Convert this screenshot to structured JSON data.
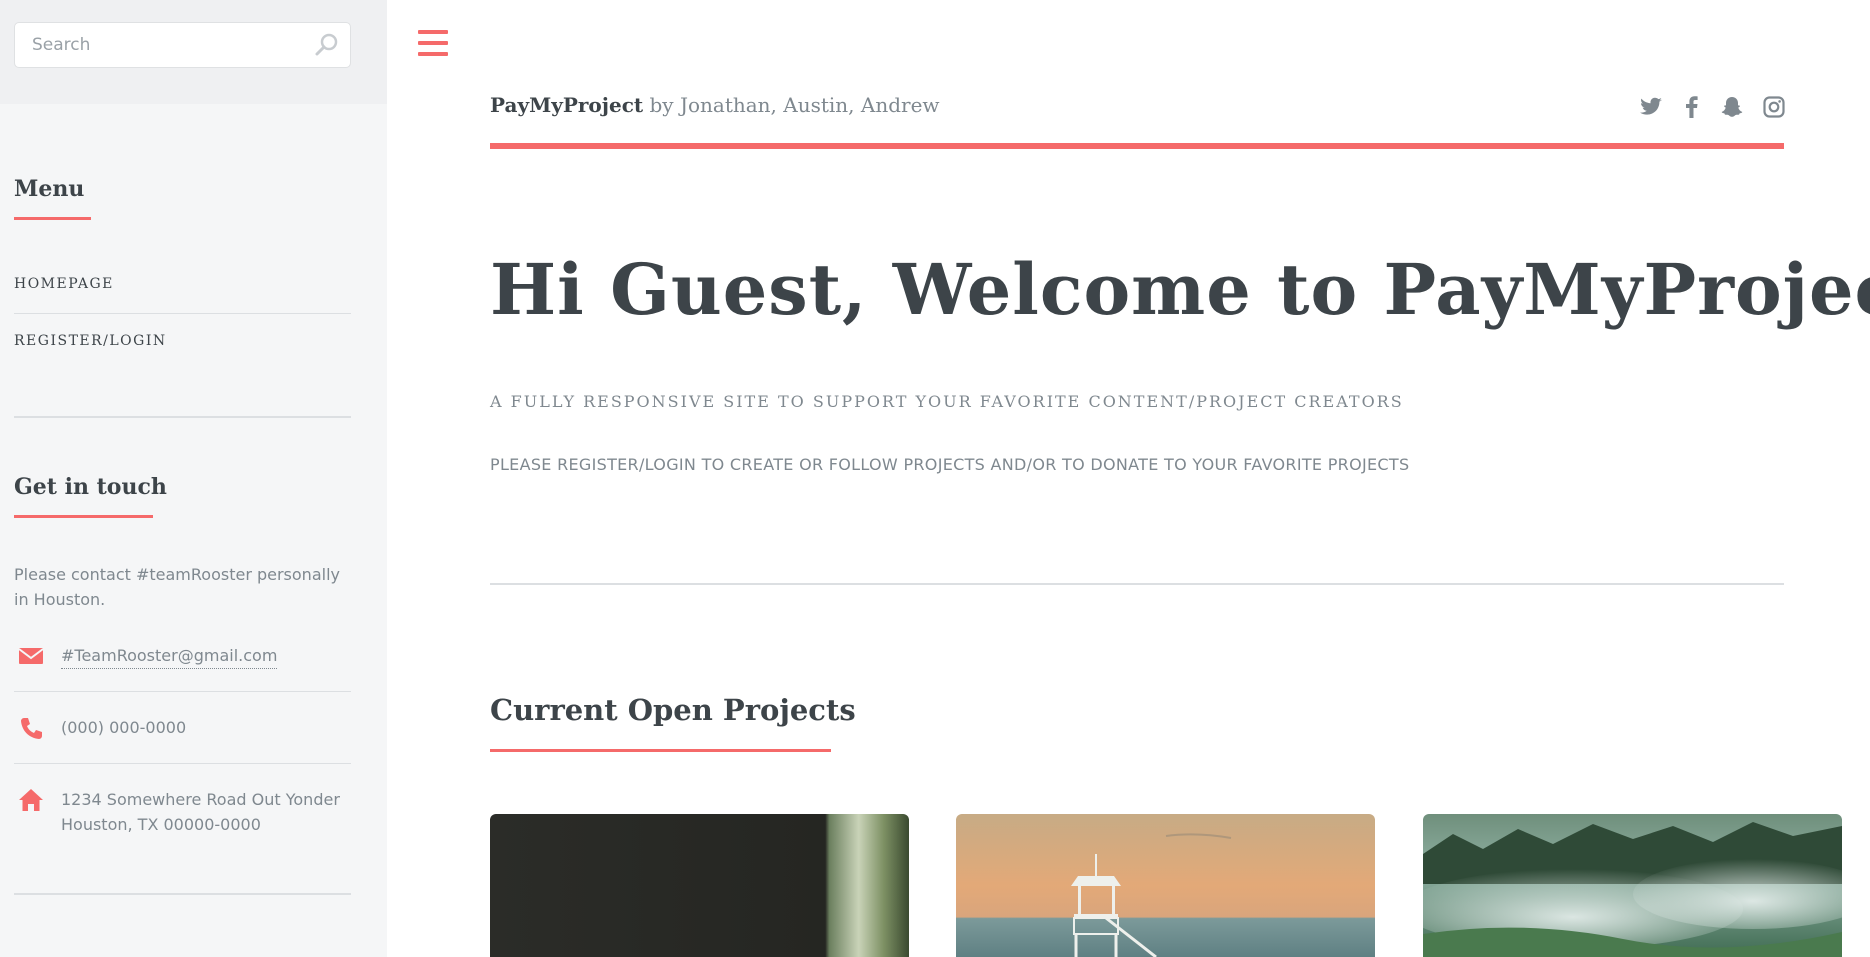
{
  "search": {
    "placeholder": "Search"
  },
  "sidebar": {
    "menu_heading": "Menu",
    "menu_items": [
      {
        "label": "HOMEPAGE"
      },
      {
        "label": "REGISTER/LOGIN"
      }
    ],
    "contact_heading": "Get in touch",
    "contact_intro": "Please contact #teamRooster personally in Houston.",
    "email": "#TeamRooster@gmail.com",
    "phone": "(000) 000-0000",
    "address_line1": "1234 Somewhere Road Out Yonder",
    "address_line2": "Houston, TX 00000-0000"
  },
  "header": {
    "brand_name": "PayMyProject",
    "brand_suffix": " by Jonathan, Austin, Andrew",
    "socials": [
      "twitter-icon",
      "facebook-icon",
      "snapchat-icon",
      "instagram-icon"
    ]
  },
  "hero": {
    "title": "Hi Guest, Welcome to PayMyProject",
    "subtitle": "A FULLY RESPONSIVE SITE TO SUPPORT YOUR FAVORITE CONTENT/PROJECT CREATORS",
    "note": "PLEASE REGISTER/LOGIN TO CREATE OR FOLLOW PROJECTS AND/OR TO DONATE TO YOUR FAVORITE PROJECTS"
  },
  "projects": {
    "heading": "Current Open Projects"
  },
  "colors": {
    "accent": "#f56a6a",
    "text": "#3d4449",
    "muted": "#7f888f",
    "sidebar_bg": "#f5f6f7"
  }
}
